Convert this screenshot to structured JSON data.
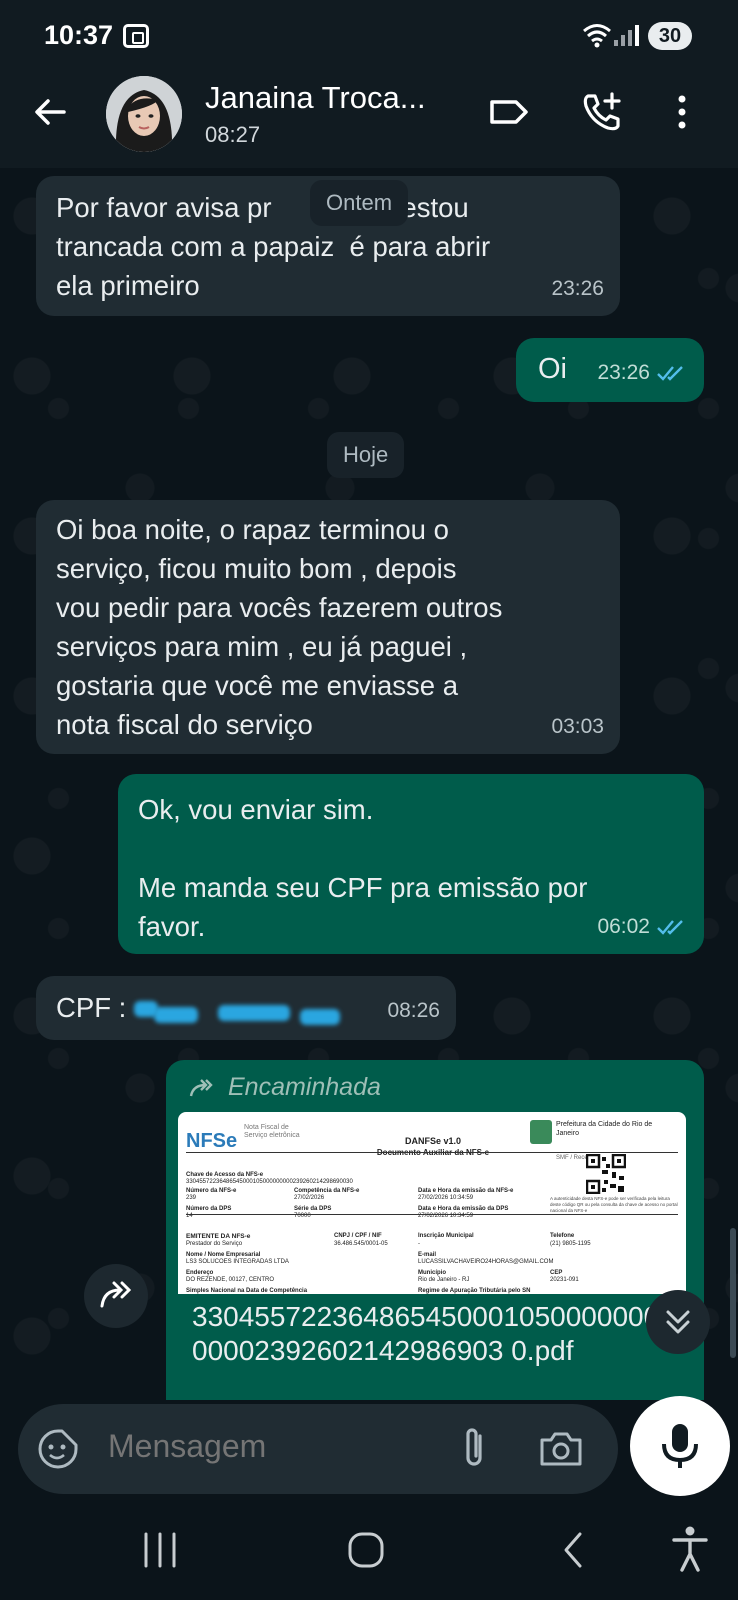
{
  "status": {
    "time": "10:37",
    "battery": "30"
  },
  "header": {
    "name": "Janaina Troca...",
    "subtitle": "08:27"
  },
  "messages": [
    {
      "id": "m1",
      "dir": "in",
      "text": "Por favor avisa pr          que estou\ntrancada com a papaiz  é para abrir\nela primeiro",
      "time": "23:26"
    },
    {
      "id": "m2",
      "dir": "out",
      "text": "Oi",
      "time": "23:26"
    },
    {
      "id": "m3",
      "dir": "in",
      "text": "Oi boa noite, o rapaz terminou o\nserviço, ficou muito bom , depois\nvou pedir para vocês fazerem outros\nserviços para mim , eu já paguei ,\ngostaria que você me enviasse a\nnota fiscal do serviço",
      "time": "03:03"
    },
    {
      "id": "m4",
      "dir": "out",
      "text": "Ok, vou enviar sim.\n\nMe manda seu CPF pra emissão por\nfavor.",
      "time": "06:02"
    },
    {
      "id": "m5",
      "dir": "in",
      "text": "CPF : ",
      "time": "08:26"
    }
  ],
  "date_pills": {
    "yesterday": "Ontem",
    "today": "Hoje"
  },
  "forwarded": {
    "label": "Encaminhada",
    "filename": "33045572236486545000105000000000002392602142986903 0.pdf",
    "doc": {
      "logo": "NFSe",
      "logo_sub": "Nota Fiscal de Serviço eletrônica",
      "title": "DANFSe v1.0",
      "subtitle": "Documento Auxiliar da NFS-e",
      "issuer": "Prefeitura da Cidade do Rio de Janeiro",
      "issuer_sub": "SMF / Receita Rio",
      "key_label": "Chave de Acesso da NFS-e",
      "key": "33045572236486545000105000000000239260214298690030",
      "nfse_no_label": "Número da NFS-e",
      "nfse_no": "239",
      "comp_label": "Competência da NFS-e",
      "comp": "27/02/2026",
      "emission_label": "Data e Hora da emissão da NFS-e",
      "emission": "27/02/2026 10:34:59",
      "dps_label": "Número da DPS",
      "dps": "14",
      "serie_label": "Série da DPS",
      "serie": "70000",
      "dps_emission_label": "Data e Hora da emissão da DPS",
      "dps_emission": "27/02/2026 10:34:59",
      "auth_note": "A autenticidade desta NFS-e pode ser verificada pela leitura deste código QR ou pela consulta da chave de acesso no portal nacional da NFS-e",
      "emitter_label": "EMITENTE DA NFS-e",
      "emitter_sub": "Prestador do Serviço",
      "cnpj_label": "CNPJ / CPF / NIF",
      "cnpj": "36.486.545/0001-05",
      "im_label": "Inscrição Municipal",
      "im": "-",
      "phone_label": "Telefone",
      "phone": "(21) 9805-1195",
      "company_label": "Nome / Nome Empresarial",
      "company": "LS3 SOLUCOES INTEGRADAS LTDA",
      "email_label": "E-mail",
      "email": "LUCASSILVACHAVEIRO24HORAS@GMAIL.COM",
      "address_label": "Endereço",
      "address": "DO REZENDE, 00127, CENTRO",
      "city_label": "Município",
      "city": "Rio de Janeiro - RJ",
      "cep_label": "CEP",
      "cep": "20231-091",
      "simples_label": "Simples Nacional na Data de Competência",
      "regime_label": "Regime de Apuração Tributária pelo SN"
    }
  },
  "input": {
    "placeholder": "Mensagem"
  }
}
